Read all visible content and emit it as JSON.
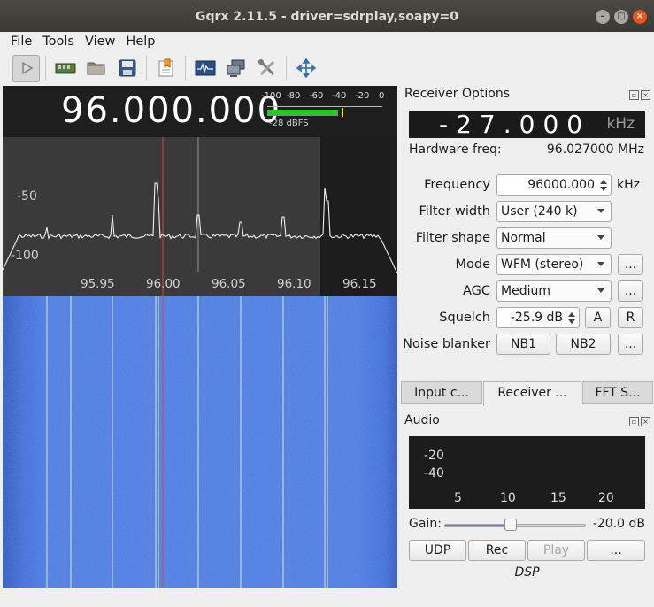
{
  "window": {
    "title": "Gqrx 2.11.5 - driver=sdrplay,soapy=0"
  },
  "menu": [
    "File",
    "Tools",
    "View",
    "Help"
  ],
  "toolbar": [
    "play-icon",
    "hardware-icon",
    "open-folder-icon",
    "save-icon",
    "bookmark-icon",
    "fft-settings-icon",
    "io-devices-icon",
    "tools-icon",
    "fullscreen-icon"
  ],
  "plotter": {
    "frequency_display": "96.000.000",
    "meter_scale": [
      "-100",
      "-80",
      "-60",
      "-40",
      "-20",
      "0"
    ],
    "meter_value_fraction": 0.68,
    "meter_label": "-28 dBFS",
    "spectrum_y_labels": [
      "-50",
      "-100"
    ],
    "spectrum_x_labels": [
      "95.95",
      "96.00",
      "96.05",
      "96.10",
      "96.15"
    ]
  },
  "receiver": {
    "title": "Receiver Options",
    "offset": "-27.000",
    "offset_unit": "kHz",
    "hw_freq_label": "Hardware freq:",
    "hw_freq_value": "96.027000 MHz",
    "frequency_label": "Frequency",
    "frequency_value": "96000.000",
    "frequency_unit": "kHz",
    "filter_width_label": "Filter width",
    "filter_width_value": "User (240 k)",
    "filter_shape_label": "Filter shape",
    "filter_shape_value": "Normal",
    "mode_label": "Mode",
    "mode_value": "WFM (stereo)",
    "agc_label": "AGC",
    "agc_value": "Medium",
    "squelch_label": "Squelch",
    "squelch_value": "-25.9 dB",
    "noise_blanker_label": "Noise blanker",
    "nb1": "NB1",
    "nb2": "NB2",
    "more": "...",
    "a_btn": "A",
    "r_btn": "R"
  },
  "tabs": [
    "Input c...",
    "Receiver ...",
    "FFT S..."
  ],
  "audio": {
    "title": "Audio",
    "y_labels": [
      "-20",
      "-40"
    ],
    "x_labels": [
      "5",
      "10",
      "15",
      "20"
    ],
    "gain_label": "Gain:",
    "gain_value": "-20.0 dB",
    "gain_fraction": 0.46,
    "buttons": [
      "UDP",
      "Rec",
      "Play",
      "..."
    ],
    "dsp_label": "DSP"
  }
}
